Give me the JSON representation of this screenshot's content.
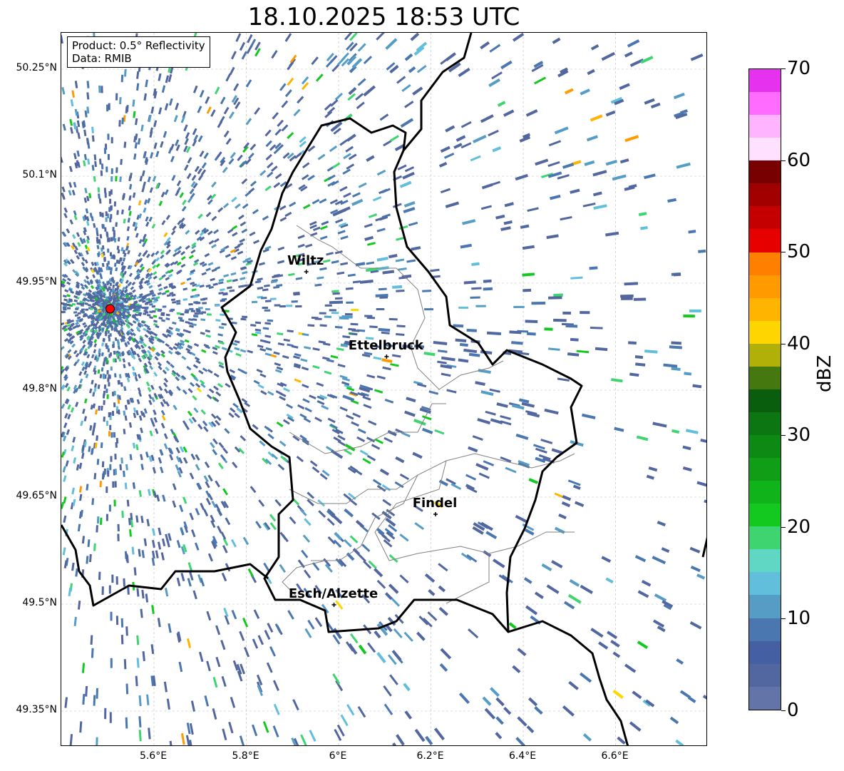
{
  "title": "18.10.2025 18:53 UTC",
  "info_box": {
    "product": "Product: 0.5° Reflectivity",
    "data": "Data: RMIB"
  },
  "map_extent": {
    "lon": [
      5.4,
      6.8
    ],
    "lat": [
      49.3,
      50.3
    ]
  },
  "x_ticks": [
    {
      "value": 5.6,
      "label": "5.6°E"
    },
    {
      "value": 5.8,
      "label": "5.8°E"
    },
    {
      "value": 6.0,
      "label": "6°E"
    },
    {
      "value": 6.2,
      "label": "6.2°E"
    },
    {
      "value": 6.4,
      "label": "6.4°E"
    },
    {
      "value": 6.6,
      "label": "6.6°E"
    }
  ],
  "y_ticks": [
    {
      "value": 50.25,
      "label": "50.25°N"
    },
    {
      "value": 50.1,
      "label": "50.1°N"
    },
    {
      "value": 49.95,
      "label": "49.95°N"
    },
    {
      "value": 49.8,
      "label": "49.8°N"
    },
    {
      "value": 49.65,
      "label": "49.65°N"
    },
    {
      "value": 49.5,
      "label": "49.5°N"
    },
    {
      "value": 49.35,
      "label": "49.35°N"
    }
  ],
  "cities": [
    {
      "name": "Wiltz",
      "lon": 5.93,
      "lat": 49.966
    },
    {
      "name": "Ettelbruck",
      "lon": 6.104,
      "lat": 49.847
    },
    {
      "name": "Findel",
      "lon": 6.21,
      "lat": 49.626
    },
    {
      "name": "Esch/Alzette",
      "lon": 5.99,
      "lat": 49.499
    }
  ],
  "radar_site": {
    "lon": 5.505,
    "lat": 49.914,
    "color": "#ff0000"
  },
  "colorbar": {
    "label": "dBZ",
    "min": 0,
    "max": 70,
    "step": 2.5,
    "ticks": [
      "0",
      "10",
      "20",
      "30",
      "40",
      "50",
      "60",
      "70"
    ],
    "colors": [
      "#6274a8",
      "#52679f",
      "#4460a3",
      "#4a77b0",
      "#569dc5",
      "#62bfdc",
      "#60d6c4",
      "#3ed470",
      "#13c81e",
      "#10b41a",
      "#0f9e16",
      "#0d8a14",
      "#0b7612",
      "#095e0e",
      "#45780f",
      "#b0b008",
      "#ffd500",
      "#ffb400",
      "#ff9a00",
      "#ff7f00",
      "#e60000",
      "#c40000",
      "#a00000",
      "#780000",
      "#ffe0ff",
      "#ffb4ff",
      "#ff6cff",
      "#e632ee"
    ]
  }
}
